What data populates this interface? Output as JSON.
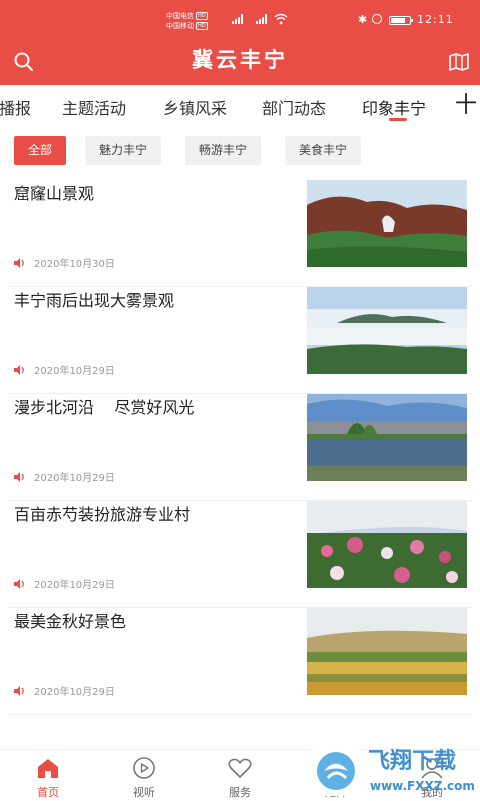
{
  "colors": {
    "accent": "#e84e45",
    "chip_bg": "#f1f1f1",
    "date": "#999999"
  },
  "status_bar": {
    "carrier1": "中国电信",
    "carrier2": "中国移动",
    "badge": "HD",
    "time": "12:11"
  },
  "header": {
    "title": "冀云丰宁",
    "search_icon": "search-icon",
    "map_icon": "map-icon"
  },
  "tabs": [
    {
      "label": "播报"
    },
    {
      "label": "主题活动"
    },
    {
      "label": "乡镇风采"
    },
    {
      "label": "部门动态"
    },
    {
      "label": "印象丰宁",
      "active": true
    }
  ],
  "tabs_more": "十",
  "chips": [
    {
      "label": "全部",
      "active": true
    },
    {
      "label": "魅力丰宁"
    },
    {
      "label": "畅游丰宁"
    },
    {
      "label": "美食丰宁"
    }
  ],
  "news": [
    {
      "title": "窟窿山景观",
      "date": "2020年10月30日"
    },
    {
      "title": "丰宁雨后出现大雾景观",
      "date": "2020年10月29日"
    },
    {
      "title": "漫步北河沿    尽赏好风光",
      "date": "2020年10月29日"
    },
    {
      "title": "百亩赤芍装扮旅游专业村",
      "date": "2020年10月29日"
    },
    {
      "title": "最美金秋好景色",
      "date": "2020年10月29日"
    }
  ],
  "bottom_nav": [
    {
      "label": "首页",
      "icon": "home-icon",
      "active": true
    },
    {
      "label": "视听",
      "icon": "play-icon"
    },
    {
      "label": "服务",
      "icon": "heart-icon"
    },
    {
      "label": "矩阵",
      "icon": "matrix-icon"
    },
    {
      "label": "我的",
      "icon": "user-icon"
    }
  ],
  "watermark": {
    "title": "飞翔下载",
    "url": "www.FXXZ.com"
  }
}
